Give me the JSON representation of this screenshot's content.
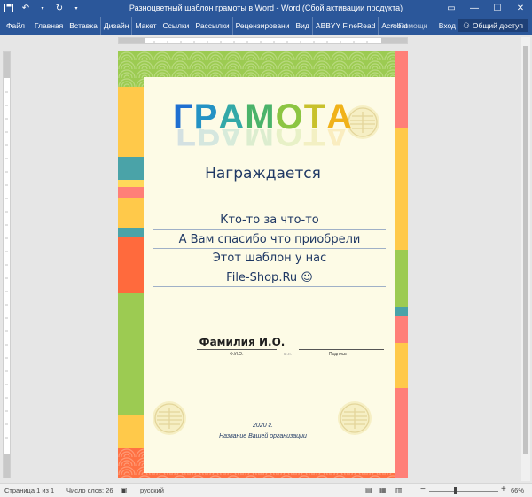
{
  "window": {
    "title": "Разноцветный шаблон грамоты в Word - Word (Сбой активации продукта)",
    "colors": {
      "titlebar": "#2b579a"
    }
  },
  "quick_access": {
    "save_icon": "save-icon",
    "undo_icon": "undo-icon",
    "redo_icon": "redo-icon"
  },
  "window_controls": {
    "ribbon_options_icon": "ribbon-display-icon",
    "minimize_icon": "minimize-icon",
    "maximize_icon": "maximize-icon",
    "close_icon": "close-icon"
  },
  "ribbon": {
    "tabs": [
      "Файл",
      "Главная",
      "Вставка",
      "Дизайн",
      "Макет",
      "Ссылки",
      "Рассылки",
      "Рецензировани",
      "Вид",
      "ABBYY FineRead",
      "Acrobat"
    ],
    "help": "Помощн",
    "signin": "Вход",
    "share": "Общий доступ"
  },
  "document": {
    "heading": "ГРАМОТА",
    "heading_colors": [
      "#1f6fd1",
      "#2492c4",
      "#33a9a8",
      "#4bb36a",
      "#8cc542",
      "#c8c12c",
      "#f0b21a"
    ],
    "awarded": "Награждается",
    "lines": [
      "Кто-то за что-то",
      "А Вам спасибо что приобрели",
      "Этот шаблон у нас",
      "File-Shop.Ru ☺"
    ],
    "name": "Фамилия И.О.",
    "caption_fio": "Ф.И.О.",
    "caption_mp": "м.п.",
    "caption_sign": "Подпись",
    "year": "2020 г.",
    "org": "Название Вашей организации",
    "colors": {
      "page_bg": "#fdfbe6",
      "top_band": "#9ccb52",
      "bottom_band": "#ff7143",
      "text": "#1f3864"
    }
  },
  "status_bar": {
    "page": "Страница 1 из 1",
    "words": "Число слов: 26",
    "proofing_icon": "proofing-icon",
    "language": "русский",
    "zoom": "66%",
    "zoom_out": "−",
    "zoom_in": "+"
  }
}
